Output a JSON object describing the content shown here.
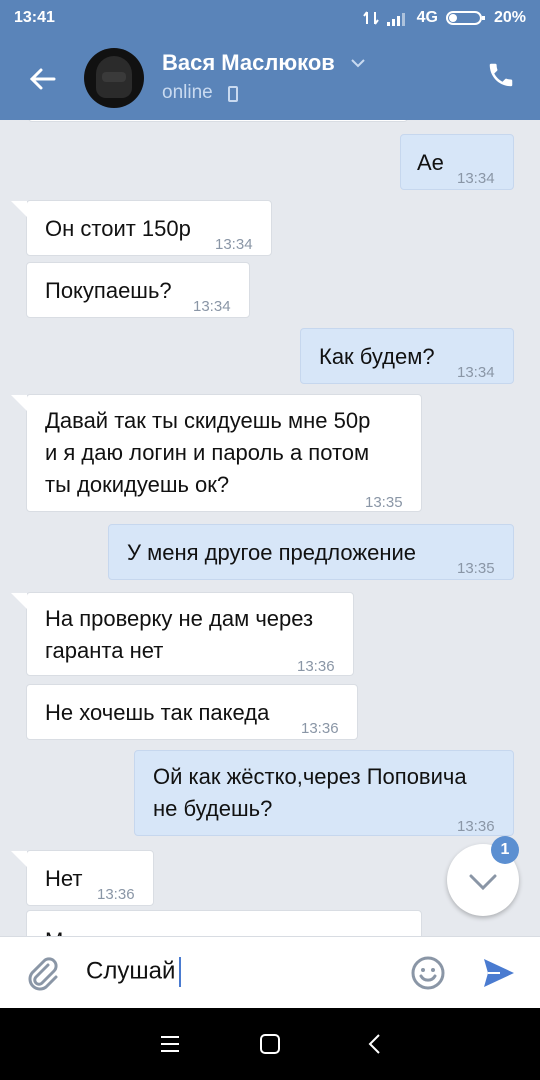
{
  "statusbar": {
    "time": "13:41",
    "network": "4G",
    "battery": "20%"
  },
  "header": {
    "contact_name": "Вася Маслюков",
    "status": "online"
  },
  "messages": [
    {
      "dir": "out",
      "text": "Ае",
      "time": "13:34"
    },
    {
      "dir": "in",
      "text": "Он стоит 150р",
      "time": "13:34"
    },
    {
      "dir": "in",
      "text": "Покупаешь?",
      "time": "13:34"
    },
    {
      "dir": "out",
      "text": "Как будем?",
      "time": "13:34"
    },
    {
      "dir": "in",
      "lines": [
        "Давай так ты скидуешь мне 50р",
        "и я даю логин и пароль а потом",
        "ты докидуешь ок?"
      ],
      "time": "13:35"
    },
    {
      "dir": "out",
      "text": "У меня другое предложение",
      "time": "13:35"
    },
    {
      "dir": "in",
      "lines": [
        "На проверку не дам через",
        "гаранта нет"
      ],
      "time": "13:36"
    },
    {
      "dir": "in",
      "text": "Не хочешь так пакеда",
      "time": "13:36"
    },
    {
      "dir": "out",
      "lines": [
        "Ой как жёстко,через Поповича",
        "не будешь?"
      ],
      "time": "13:36"
    },
    {
      "dir": "in",
      "text": "Нет",
      "time": "13:36"
    },
    {
      "dir": "in",
      "text": "Меня уже кидали так не хочешь",
      "time": ""
    }
  ],
  "scroll_button": {
    "unread_count": "1"
  },
  "composer": {
    "input_value": "Слушай"
  },
  "colors": {
    "header": "#5a84b9",
    "incoming": "#ffffff",
    "outgoing": "#d7e6f8",
    "accent": "#4a7bd0"
  },
  "icons": [
    "back-arrow-icon",
    "chevron-down-icon",
    "phone-icon",
    "paperclip-icon",
    "emoji-icon",
    "send-icon",
    "menu-icon",
    "home-icon",
    "back-icon"
  ]
}
